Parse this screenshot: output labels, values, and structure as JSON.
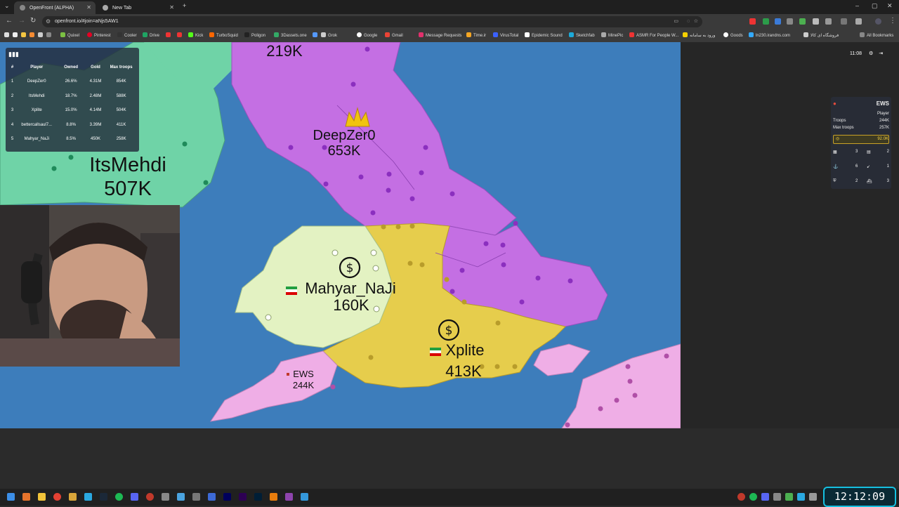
{
  "browser": {
    "tabs": [
      {
        "title": "OpenFront (ALPHA)"
      },
      {
        "title": "New Tab"
      }
    ],
    "url": "openfront.io/#join=aNjs5AW1",
    "bookmarks": [
      "Quixel",
      "Pinterest",
      "Cooler",
      "Drive",
      "Kick",
      "TurboSquid",
      "Poligon",
      "3Dassets.one",
      "Grok",
      "Google",
      "Gmail",
      "Message Requests",
      "Time.ir",
      "VirusTotal",
      "Epidemic Sound",
      "Sketchfab",
      "MinePic",
      "ASMR For People W...",
      "ورود به سامانه",
      "Goods",
      "ln230.irandns.com",
      "فروشگاه ای کالا",
      "All Bookmarks"
    ]
  },
  "leaderboard": {
    "headers": [
      "#",
      "Player",
      "Owned",
      "Gold",
      "Max troops"
    ],
    "rows": [
      [
        "1",
        "DeepZer0",
        "26.6%",
        "4.31M",
        "854K"
      ],
      [
        "2",
        "ItsMehdi",
        "18.7%",
        "2.48M",
        "588K"
      ],
      [
        "3",
        "Xplite",
        "15.0%",
        "4.14M",
        "504K"
      ],
      [
        "4",
        "bettercallsaul7...",
        "8.8%",
        "3.39M",
        "411K"
      ],
      [
        "5",
        "Mahyar_NaJi",
        "8.5%",
        "450K",
        "258K"
      ]
    ]
  },
  "map_labels": {
    "top_troops": "219K",
    "deepzer0_name": "DeepZer0",
    "deepzer0_troops": "653K",
    "itsmehdi_name": "ItsMehdi",
    "itsmehdi_troops": "507K",
    "mahyar_name": "Mahyar_NaJi",
    "mahyar_troops": "160K",
    "xplite_name": "Xplite",
    "xplite_troops": "413K",
    "ews_name": "EWS",
    "ews_troops": "244K"
  },
  "hud": {
    "timer": "11:08"
  },
  "player_info": {
    "name": "EWS",
    "type": "Player",
    "troops_label": "Troops",
    "troops": "244K",
    "max_troops_label": "Max troops",
    "max_troops": "257K",
    "gold": "92.0K",
    "buildings": [
      "3",
      "2",
      "6",
      "1",
      "2",
      "3"
    ]
  },
  "overlay_clock": "12:12:09",
  "colors": {
    "ocean": "#3d7dbb",
    "deepzer0": "#c46fe3",
    "itsmehdi": "#6fd3a7",
    "xplite": "#e6cd4c",
    "mahyar": "#e3f2c2",
    "ews": "#efaee6"
  }
}
